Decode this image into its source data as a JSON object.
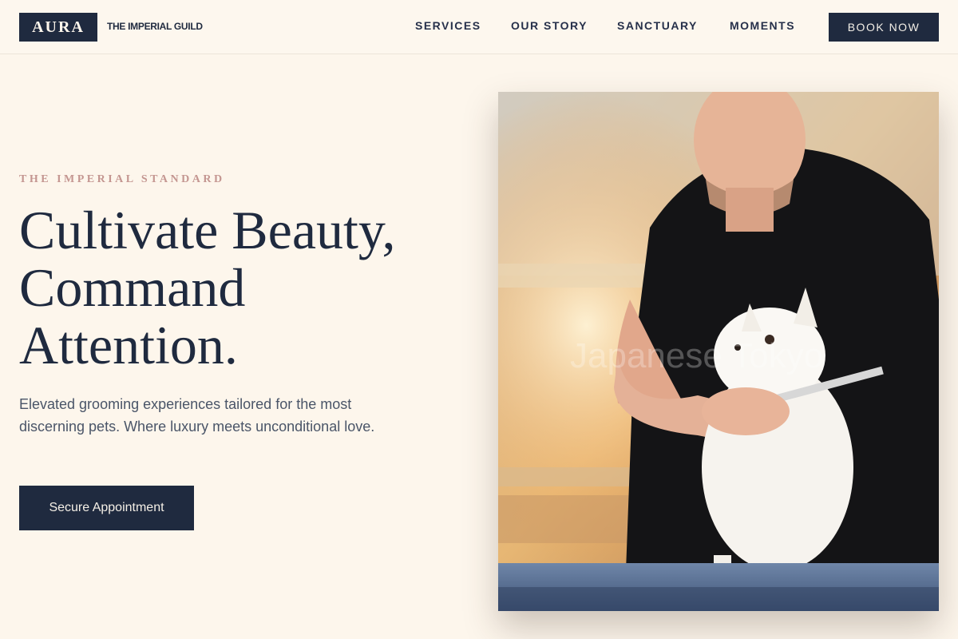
{
  "header": {
    "logo": "AURA",
    "tagline": "THE IMPERIAL GUILD",
    "nav": [
      "SERVICES",
      "OUR STORY",
      "SANCTUARY",
      "MOMENTS"
    ],
    "cta": "BOOK NOW"
  },
  "hero": {
    "eyebrow": "THE IMPERIAL STANDARD",
    "headline_lines": [
      "Cultivate Beauty,",
      "Command",
      "Attention."
    ],
    "subtext": "Elevated grooming experiences tailored for the most discerning pets. Where luxury meets unconditional love.",
    "button": "Secure Appointment",
    "image_watermark": "Japanese Tokyo"
  },
  "colors": {
    "navy": "#1f2a3f",
    "cream": "#fdf6ec",
    "rose": "#c49691"
  }
}
